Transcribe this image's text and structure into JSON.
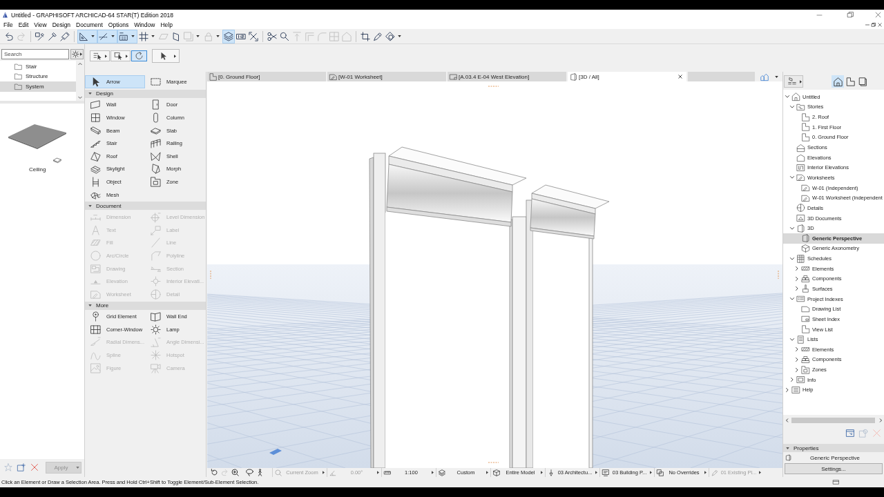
{
  "window": {
    "title": "Untitled - GRAPHISOFT ARCHICAD-64 STAR(T) Edition 2018"
  },
  "menu": [
    "File",
    "Edit",
    "View",
    "Design",
    "Document",
    "Options",
    "Window",
    "Help"
  ],
  "toolbar": [
    [
      {
        "kind": "undo",
        "on": false,
        "disabled": false,
        "menu": false
      },
      {
        "kind": "redo",
        "on": false,
        "disabled": true,
        "menu": false
      }
    ],
    [
      {
        "kind": "eyedropper-box",
        "on": false,
        "disabled": false,
        "menu": false
      },
      {
        "kind": "eyedropper",
        "on": false,
        "disabled": false,
        "menu": false
      },
      {
        "kind": "syringe",
        "on": false,
        "disabled": false,
        "menu": false
      }
    ],
    [
      {
        "kind": "set-square",
        "on": true,
        "disabled": false,
        "menu": true
      },
      {
        "kind": "guide-line",
        "on": true,
        "disabled": false,
        "menu": true
      },
      {
        "kind": "grid-snap",
        "on": true,
        "disabled": false,
        "menu": true
      },
      {
        "kind": "hash-grid",
        "on": false,
        "disabled": false,
        "menu": true
      },
      {
        "kind": "parallelogram",
        "on": false,
        "disabled": true,
        "menu": false
      },
      {
        "kind": "plane",
        "on": false,
        "disabled": false,
        "menu": false
      },
      {
        "kind": "square-shadow",
        "on": false,
        "disabled": true,
        "menu": true
      },
      {
        "kind": "lock",
        "on": false,
        "disabled": true,
        "menu": true
      },
      {
        "kind": "layers",
        "on": true,
        "disabled": false,
        "menu": false
      },
      {
        "kind": "scale-box",
        "on": false,
        "disabled": false,
        "menu": false
      },
      {
        "kind": "cross-arrows",
        "on": false,
        "disabled": false,
        "menu": false
      }
    ],
    [
      {
        "kind": "scissors",
        "on": false,
        "disabled": false,
        "menu": false
      },
      {
        "kind": "magnifier-wrench",
        "on": false,
        "disabled": false,
        "menu": false
      },
      {
        "kind": "split-arrow",
        "on": false,
        "disabled": true,
        "menu": false
      },
      {
        "kind": "corner",
        "on": false,
        "disabled": true,
        "menu": false
      },
      {
        "kind": "fillet",
        "on": false,
        "disabled": true,
        "menu": false
      },
      {
        "kind": "grid-box",
        "on": false,
        "disabled": true,
        "menu": false
      },
      {
        "kind": "house",
        "on": false,
        "disabled": true,
        "menu": false
      }
    ],
    [
      {
        "kind": "transform",
        "on": false,
        "disabled": false,
        "menu": false
      },
      {
        "kind": "pen",
        "on": false,
        "disabled": false,
        "menu": false
      },
      {
        "kind": "shapes",
        "on": false,
        "disabled": false,
        "menu": true
      }
    ]
  ],
  "info_box": [
    {
      "kind": "dot-grid",
      "selected": false,
      "menu": true
    },
    {
      "kind": "dashed-box",
      "selected": false,
      "menu": true
    },
    {
      "kind": "rotate",
      "selected": true,
      "menu": false
    },
    {
      "kind": "arrow",
      "selected": false,
      "menu": true
    }
  ],
  "library": {
    "search": {
      "placeholder": "Search"
    },
    "folders": [
      {
        "label": "Stair",
        "selected": false
      },
      {
        "label": "Structure",
        "selected": false
      },
      {
        "label": "System",
        "selected": true
      }
    ],
    "preview": {
      "label": "Ceiling"
    },
    "actions": [
      {
        "kind": "star",
        "disabled": true
      },
      {
        "kind": "doc-plus",
        "disabled": false
      },
      {
        "kind": "remove",
        "disabled": false
      }
    ],
    "apply": {
      "label": "Apply",
      "disabled": true
    }
  },
  "toolbox": {
    "top": [
      {
        "label": "Arrow",
        "kind": "arrow",
        "selected": true
      },
      {
        "label": "Marquee",
        "kind": "marquee",
        "selected": false
      }
    ],
    "groups": [
      {
        "title": "Design",
        "expanded": true,
        "tools": [
          {
            "label": "Wall",
            "kind": "wall",
            "selected": false,
            "disabled": false
          },
          {
            "label": "Door",
            "kind": "door",
            "selected": false,
            "disabled": false
          },
          {
            "label": "Window",
            "kind": "window",
            "selected": false,
            "disabled": false
          },
          {
            "label": "Column",
            "kind": "column",
            "selected": false,
            "disabled": false
          },
          {
            "label": "Beam",
            "kind": "beam",
            "selected": false,
            "disabled": false
          },
          {
            "label": "Slab",
            "kind": "slab",
            "selected": false,
            "disabled": false
          },
          {
            "label": "Stair",
            "kind": "stair",
            "selected": false,
            "disabled": false
          },
          {
            "label": "Railing",
            "kind": "railing",
            "selected": false,
            "disabled": false
          },
          {
            "label": "Roof",
            "kind": "roof",
            "selected": false,
            "disabled": false
          },
          {
            "label": "Shell",
            "kind": "shell",
            "selected": false,
            "disabled": false
          },
          {
            "label": "Skylight",
            "kind": "skylight",
            "selected": false,
            "disabled": false
          },
          {
            "label": "Morph",
            "kind": "morph",
            "selected": false,
            "disabled": false
          },
          {
            "label": "Object",
            "kind": "object",
            "selected": false,
            "disabled": false
          },
          {
            "label": "Zone",
            "kind": "zone",
            "selected": false,
            "disabled": false
          },
          {
            "label": "Mesh",
            "kind": "mesh",
            "selected": false,
            "disabled": false
          }
        ]
      },
      {
        "title": "Document",
        "expanded": true,
        "tools": [
          {
            "label": "Dimension",
            "kind": "dimension",
            "selected": false,
            "disabled": true
          },
          {
            "label": "Level Dimension",
            "kind": "level-dimension",
            "selected": false,
            "disabled": true
          },
          {
            "label": "Text",
            "kind": "text",
            "selected": false,
            "disabled": true
          },
          {
            "label": "Label",
            "kind": "label",
            "selected": false,
            "disabled": true
          },
          {
            "label": "Fill",
            "kind": "fill",
            "selected": false,
            "disabled": true
          },
          {
            "label": "Line",
            "kind": "line",
            "selected": false,
            "disabled": true
          },
          {
            "label": "Arc/Circle",
            "kind": "arc",
            "selected": false,
            "disabled": true
          },
          {
            "label": "Polyline",
            "kind": "polyline",
            "selected": false,
            "disabled": true
          },
          {
            "label": "Drawing",
            "kind": "drawing",
            "selected": false,
            "disabled": true
          },
          {
            "label": "Section",
            "kind": "section-line",
            "selected": false,
            "disabled": true
          },
          {
            "label": "Elevation",
            "kind": "elevation-marker",
            "selected": false,
            "disabled": true
          },
          {
            "label": "Interior Elevati...",
            "kind": "interior-marker",
            "selected": false,
            "disabled": true
          },
          {
            "label": "Worksheet",
            "kind": "worksheet",
            "selected": false,
            "disabled": true
          },
          {
            "label": "Detail",
            "kind": "detail",
            "selected": false,
            "disabled": true
          }
        ]
      },
      {
        "title": "More",
        "expanded": true,
        "tools": [
          {
            "label": "Grid Element",
            "kind": "grid-element",
            "selected": false,
            "disabled": false
          },
          {
            "label": "Wall End",
            "kind": "wall-end",
            "selected": false,
            "disabled": false
          },
          {
            "label": "Corner-Window",
            "kind": "corner-window",
            "selected": false,
            "disabled": false
          },
          {
            "label": "Lamp",
            "kind": "lamp",
            "selected": false,
            "disabled": false
          },
          {
            "label": "Radial Dimens...",
            "kind": "radial-dimension",
            "selected": false,
            "disabled": true
          },
          {
            "label": "Angle Dimensi...",
            "kind": "angle-dimension",
            "selected": false,
            "disabled": true
          },
          {
            "label": "Spline",
            "kind": "spline",
            "selected": false,
            "disabled": true
          },
          {
            "label": "Hotspot",
            "kind": "hotspot",
            "selected": false,
            "disabled": true
          },
          {
            "label": "Figure",
            "kind": "figure",
            "selected": false,
            "disabled": true
          },
          {
            "label": "Camera",
            "kind": "camera",
            "selected": false,
            "disabled": true
          }
        ]
      }
    ]
  },
  "tabs": [
    {
      "label": "[0. Ground Floor]",
      "kind": "plan",
      "selected": false
    },
    {
      "label": "[W-01 Worksheet]",
      "kind": "worksheet",
      "selected": false
    },
    {
      "label": "[A.03.4 E-04 West Elevation]",
      "kind": "layout",
      "selected": false
    },
    {
      "label": "[3D / All]",
      "kind": "view-3d",
      "selected": true
    }
  ],
  "view_bar": {
    "tools": [
      {
        "kind": "orbit",
        "disabled": false
      },
      {
        "kind": "redo",
        "disabled": true
      },
      {
        "kind": "zoom-in",
        "disabled": false
      },
      {
        "kind": "lasso",
        "disabled": false
      },
      {
        "kind": "walk",
        "disabled": false
      }
    ],
    "fields": [
      {
        "kind": "zoom",
        "label": "Current Zoom",
        "disabled": true
      },
      {
        "kind": "angle",
        "label": "0.00°",
        "disabled": true
      },
      {
        "kind": "ruler",
        "label": "1:100",
        "disabled": false
      },
      {
        "kind": "layers",
        "label": "Custom",
        "disabled": false
      },
      {
        "kind": "model",
        "label": "Entire Model",
        "disabled": false
      },
      {
        "kind": "pen-nib",
        "label": "03 Architectu...",
        "disabled": false
      },
      {
        "kind": "display",
        "label": "03 Building P...",
        "disabled": false
      },
      {
        "kind": "overrides",
        "label": "No Overrides",
        "disabled": false
      },
      {
        "kind": "renovation",
        "label": "01 Existing Pl...",
        "disabled": true
      }
    ]
  },
  "navigator": {
    "modes": [
      {
        "kind": "project",
        "selected": true
      },
      {
        "kind": "plan",
        "selected": false
      },
      {
        "kind": "layout-book",
        "selected": false
      }
    ],
    "tree": [
      {
        "label": "Untitled",
        "kind": "project",
        "expanded": true,
        "selected": false,
        "children": [
          {
            "label": "Stories",
            "kind": "stories",
            "expanded": true,
            "selected": false,
            "children": [
              {
                "label": "2. Roof",
                "kind": "plan",
                "selected": false
              },
              {
                "label": "1. First Floor",
                "kind": "plan",
                "selected": false
              },
              {
                "label": "0. Ground Floor",
                "kind": "plan",
                "selected": false
              }
            ]
          },
          {
            "label": "Sections",
            "kind": "section",
            "selected": false
          },
          {
            "label": "Elevations",
            "kind": "elevation",
            "selected": false
          },
          {
            "label": "Interior Elevations",
            "kind": "interior-elevation",
            "selected": false
          },
          {
            "label": "Worksheets",
            "kind": "worksheet",
            "expanded": true,
            "selected": false,
            "children": [
              {
                "label": "W-01 (Independent)",
                "kind": "worksheet",
                "selected": false
              },
              {
                "label": "W-01 Worksheet (Independent",
                "kind": "worksheet",
                "selected": false
              }
            ]
          },
          {
            "label": "Details",
            "kind": "detail",
            "selected": false
          },
          {
            "label": "3D Documents",
            "kind": "document-3d",
            "selected": false
          },
          {
            "label": "3D",
            "kind": "view-3d",
            "expanded": true,
            "selected": false,
            "children": [
              {
                "label": "Generic Perspective",
                "kind": "view-3d",
                "selected": true
              },
              {
                "label": "Generic Axonometry",
                "kind": "axonometry",
                "selected": false
              }
            ]
          },
          {
            "label": "Schedules",
            "kind": "schedule",
            "expanded": true,
            "selected": false,
            "children": [
              {
                "label": "Elements",
                "kind": "elements",
                "expanded": false,
                "selected": false
              },
              {
                "label": "Components",
                "kind": "components",
                "expanded": false,
                "selected": false
              },
              {
                "label": "Surfaces",
                "kind": "surfaces",
                "expanded": false,
                "selected": false
              }
            ]
          },
          {
            "label": "Project Indexes",
            "kind": "index",
            "expanded": true,
            "selected": false,
            "children": [
              {
                "label": "Drawing List",
                "kind": "page",
                "selected": false
              },
              {
                "label": "Sheet Index",
                "kind": "sheet",
                "selected": false
              },
              {
                "label": "View List",
                "kind": "plan",
                "selected": false
              }
            ]
          },
          {
            "label": "Lists",
            "kind": "list",
            "expanded": true,
            "selected": false,
            "children": [
              {
                "label": "Elements",
                "kind": "elements",
                "expanded": false,
                "selected": false
              },
              {
                "label": "Components",
                "kind": "components",
                "expanded": false,
                "selected": false
              },
              {
                "label": "Zones",
                "kind": "zone",
                "expanded": false,
                "selected": false
              }
            ]
          },
          {
            "label": "Info",
            "kind": "info",
            "expanded": false,
            "selected": false
          }
        ]
      },
      {
        "label": "Help",
        "kind": "help",
        "expanded": false,
        "selected": false
      }
    ],
    "actions": [
      {
        "kind": "new-view",
        "disabled": false
      },
      {
        "kind": "clone",
        "disabled": true
      },
      {
        "kind": "remove",
        "disabled": true
      }
    ],
    "properties": {
      "title": "Properties",
      "expanded": true,
      "name": "Generic Perspective",
      "button": "Settings..."
    }
  },
  "status_bar": {
    "message": "Click an Element or Draw a Selection Area. Press and Hold Ctrl+Shift to Toggle Element/Sub-Element Selection."
  }
}
